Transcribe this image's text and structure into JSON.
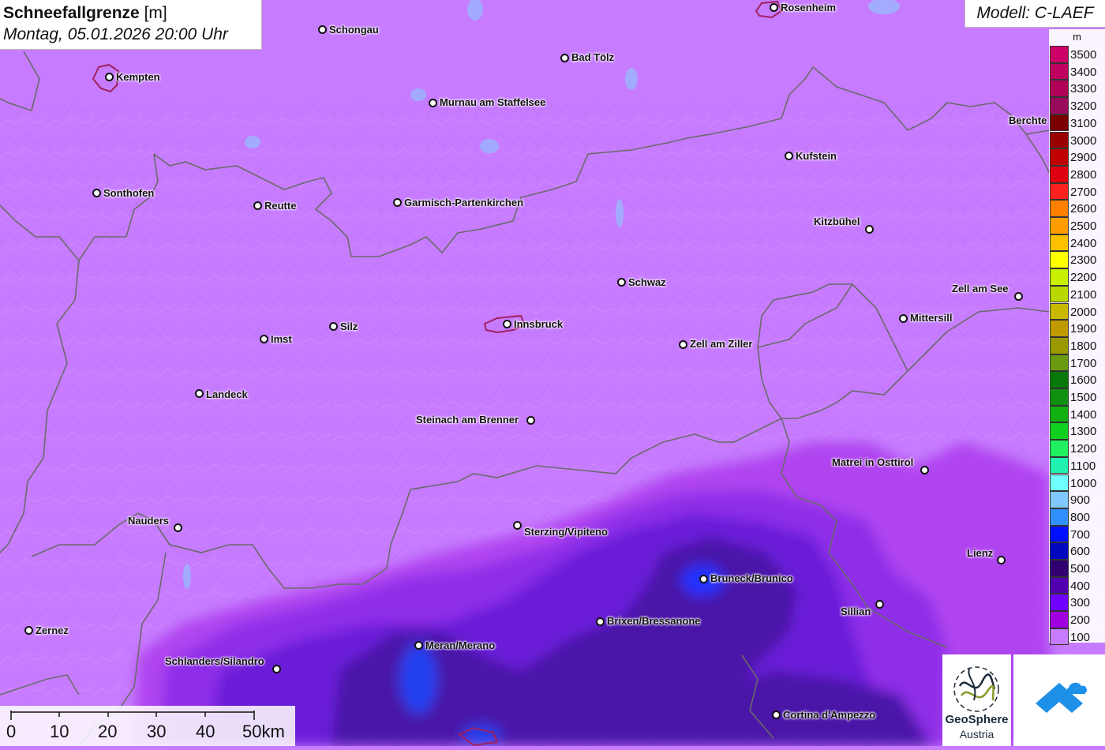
{
  "title": {
    "parameter": "Schneefallgrenze",
    "unit": "[m]",
    "datetime": "Montag, 05.01.2026 20:00 Uhr"
  },
  "model": "Modell: C-LAEF",
  "legend": {
    "unit": "m",
    "steps": [
      {
        "value": "3500",
        "color": "#cc0066"
      },
      {
        "value": "3400",
        "color": "#c0005f"
      },
      {
        "value": "3300",
        "color": "#b10058"
      },
      {
        "value": "3200",
        "color": "#9a0a5a"
      },
      {
        "value": "3100",
        "color": "#7a0000"
      },
      {
        "value": "3000",
        "color": "#9a0000"
      },
      {
        "value": "2900",
        "color": "#c00000"
      },
      {
        "value": "2800",
        "color": "#e00010"
      },
      {
        "value": "2700",
        "color": "#ff2020"
      },
      {
        "value": "2600",
        "color": "#ff8000"
      },
      {
        "value": "2500",
        "color": "#ff9c00"
      },
      {
        "value": "2400",
        "color": "#ffc000"
      },
      {
        "value": "2300",
        "color": "#ffff00"
      },
      {
        "value": "2200",
        "color": "#c8f000"
      },
      {
        "value": "2100",
        "color": "#b8d800"
      },
      {
        "value": "2000",
        "color": "#c8b800"
      },
      {
        "value": "1900",
        "color": "#c09a00"
      },
      {
        "value": "1800",
        "color": "#9a9a00"
      },
      {
        "value": "1700",
        "color": "#6a9a10"
      },
      {
        "value": "1600",
        "color": "#087808"
      },
      {
        "value": "1500",
        "color": "#109010"
      },
      {
        "value": "1400",
        "color": "#10b010"
      },
      {
        "value": "1300",
        "color": "#10d020"
      },
      {
        "value": "1200",
        "color": "#20f060"
      },
      {
        "value": "1100",
        "color": "#20f0b0"
      },
      {
        "value": "1000",
        "color": "#70ffff"
      },
      {
        "value": "900",
        "color": "#80c8ff"
      },
      {
        "value": "800",
        "color": "#3090ff"
      },
      {
        "value": "700",
        "color": "#0010ff"
      },
      {
        "value": "600",
        "color": "#0008c0"
      },
      {
        "value": "500",
        "color": "#300070"
      },
      {
        "value": "400",
        "color": "#5000b0"
      },
      {
        "value": "300",
        "color": "#7000ff"
      },
      {
        "value": "200",
        "color": "#a000e0"
      },
      {
        "value": "100",
        "color": "#c77cff"
      }
    ]
  },
  "scale_bar": {
    "labels": [
      "0",
      "10",
      "20",
      "30",
      "40",
      "50km"
    ]
  },
  "cities": [
    {
      "name": "Rosenheim",
      "key": "rosenheim"
    },
    {
      "name": "Schongau",
      "key": "schongau"
    },
    {
      "name": "Bad Tölz",
      "key": "bad-toelz"
    },
    {
      "name": "Kempten",
      "key": "kempten"
    },
    {
      "name": "Murnau am Staffelsee",
      "key": "murnau"
    },
    {
      "name": "Berchte",
      "key": "berchtesgaden"
    },
    {
      "name": "Kufstein",
      "key": "kufstein"
    },
    {
      "name": "Sonthofen",
      "key": "sonthofen"
    },
    {
      "name": "Reutte",
      "key": "reutte"
    },
    {
      "name": "Garmisch-Partenkirchen",
      "key": "garmisch"
    },
    {
      "name": "Kitzbühel",
      "key": "kitzbuehel"
    },
    {
      "name": "Schwaz",
      "key": "schwaz"
    },
    {
      "name": "Zell am See",
      "key": "zell-am-see"
    },
    {
      "name": "Mittersill",
      "key": "mittersill"
    },
    {
      "name": "Silz",
      "key": "silz"
    },
    {
      "name": "Innsbruck",
      "key": "innsbruck"
    },
    {
      "name": "Imst",
      "key": "imst"
    },
    {
      "name": "Zell am Ziller",
      "key": "zell-am-ziller"
    },
    {
      "name": "Landeck",
      "key": "landeck"
    },
    {
      "name": "Steinach am Brenner",
      "key": "steinach"
    },
    {
      "name": "Matrei in Osttirol",
      "key": "matrei"
    },
    {
      "name": "Nauders",
      "key": "nauders"
    },
    {
      "name": "Sterzing/Vipiteno",
      "key": "sterzing"
    },
    {
      "name": "Lienz",
      "key": "lienz"
    },
    {
      "name": "Bruneck/Brunico",
      "key": "bruneck"
    },
    {
      "name": "Sillian",
      "key": "sillian"
    },
    {
      "name": "Brixen/Bressanone",
      "key": "brixen"
    },
    {
      "name": "Zernez",
      "key": "zernez"
    },
    {
      "name": "Meran/Merano",
      "key": "meran"
    },
    {
      "name": "Schlanders/Silandro",
      "key": "schlanders"
    },
    {
      "name": "Cortina d'Ampezzo",
      "key": "cortina"
    }
  ],
  "logos": {
    "geosphere_line1": "GeoSphere",
    "geosphere_line2": "Austria"
  }
}
